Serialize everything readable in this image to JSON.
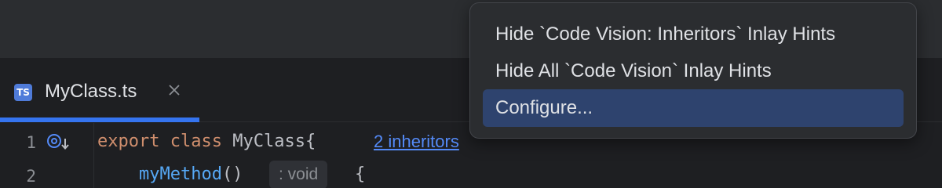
{
  "tab": {
    "icon_text": "TS",
    "title": "MyClass.ts",
    "close_icon": "close-icon"
  },
  "editor": {
    "lines": [
      {
        "number": "1",
        "keyword_export": "export",
        "keyword_class": "class",
        "class_name": "MyClass",
        "open_brace": "{",
        "inheritors_link": "2 inheritors"
      },
      {
        "number": "2",
        "method_name": "myMethod",
        "parens": "()",
        "type_hint": ": void",
        "open_brace": "{"
      }
    ],
    "gutter_icon": "implemented-icon"
  },
  "context_menu": {
    "items": [
      {
        "label": "Hide `Code Vision: Inheritors` Inlay Hints",
        "selected": false
      },
      {
        "label": "Hide All `Code Vision` Inlay Hints",
        "selected": false
      },
      {
        "label": "Configure...",
        "selected": true
      }
    ]
  },
  "colors": {
    "background": "#1e1f22",
    "panel": "#2b2d30",
    "accent": "#3574f0",
    "selection": "#2e436e",
    "keyword": "#cf8e6d",
    "function": "#56a8f5",
    "link": "#548af7"
  }
}
